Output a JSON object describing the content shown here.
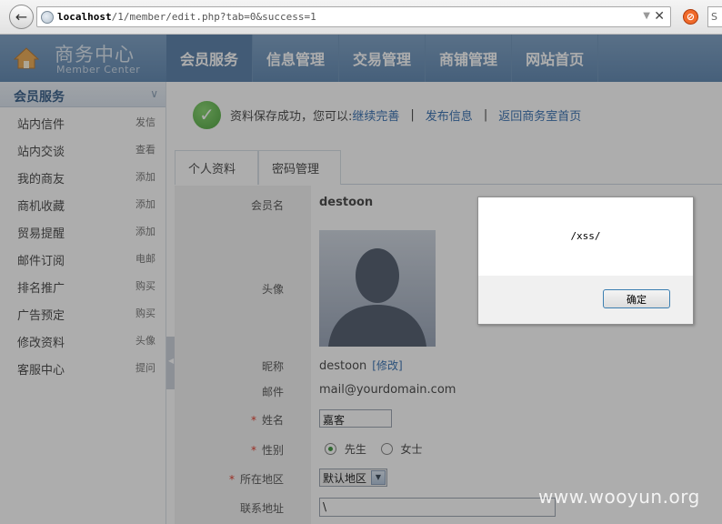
{
  "browser": {
    "url_host": "localhost",
    "url_path": "/1/member/edit.php?tab=0&success=1",
    "search_text": "S"
  },
  "header": {
    "logo_cn": "商务中心",
    "logo_en": "Member Center",
    "nav": [
      "会员服务",
      "信息管理",
      "交易管理",
      "商铺管理",
      "网站首页"
    ]
  },
  "sidebar": {
    "title": "会员服务",
    "items": [
      {
        "label": "站内信件",
        "action": "发信"
      },
      {
        "label": "站内交谈",
        "action": "查看"
      },
      {
        "label": "我的商友",
        "action": "添加"
      },
      {
        "label": "商机收藏",
        "action": "添加"
      },
      {
        "label": "贸易提醒",
        "action": "添加"
      },
      {
        "label": "邮件订阅",
        "action": "电邮"
      },
      {
        "label": "排名推广",
        "action": "购买"
      },
      {
        "label": "广告预定",
        "action": "购买"
      },
      {
        "label": "修改资料",
        "action": "头像"
      },
      {
        "label": "客服中心",
        "action": "提问"
      }
    ]
  },
  "notice": {
    "text": "资料保存成功，您可以:",
    "links": [
      "继续完善",
      "发布信息",
      "返回商务室首页"
    ],
    "separator": "|"
  },
  "tabs": [
    "个人资料",
    "密码管理"
  ],
  "form": {
    "username_label": "会员名",
    "username": "destoon",
    "avatar_label": "头像",
    "nickname_label": "昵称",
    "nickname": "destoon",
    "modify_link": "[修改]",
    "email_label": "邮件",
    "email": "mail@yourdomain.com",
    "name_label": "姓名",
    "name_value": "嘉客",
    "gender_label": "性别",
    "gender_male": "先生",
    "gender_female": "女士",
    "region_label": "所在地区",
    "region_value": "默认地区",
    "address_label": "联系地址",
    "address_value": "\\",
    "required_mark": "*"
  },
  "dialog": {
    "message": "/xss/",
    "ok_label": "确定"
  },
  "watermark": "www.wooyun.org"
}
